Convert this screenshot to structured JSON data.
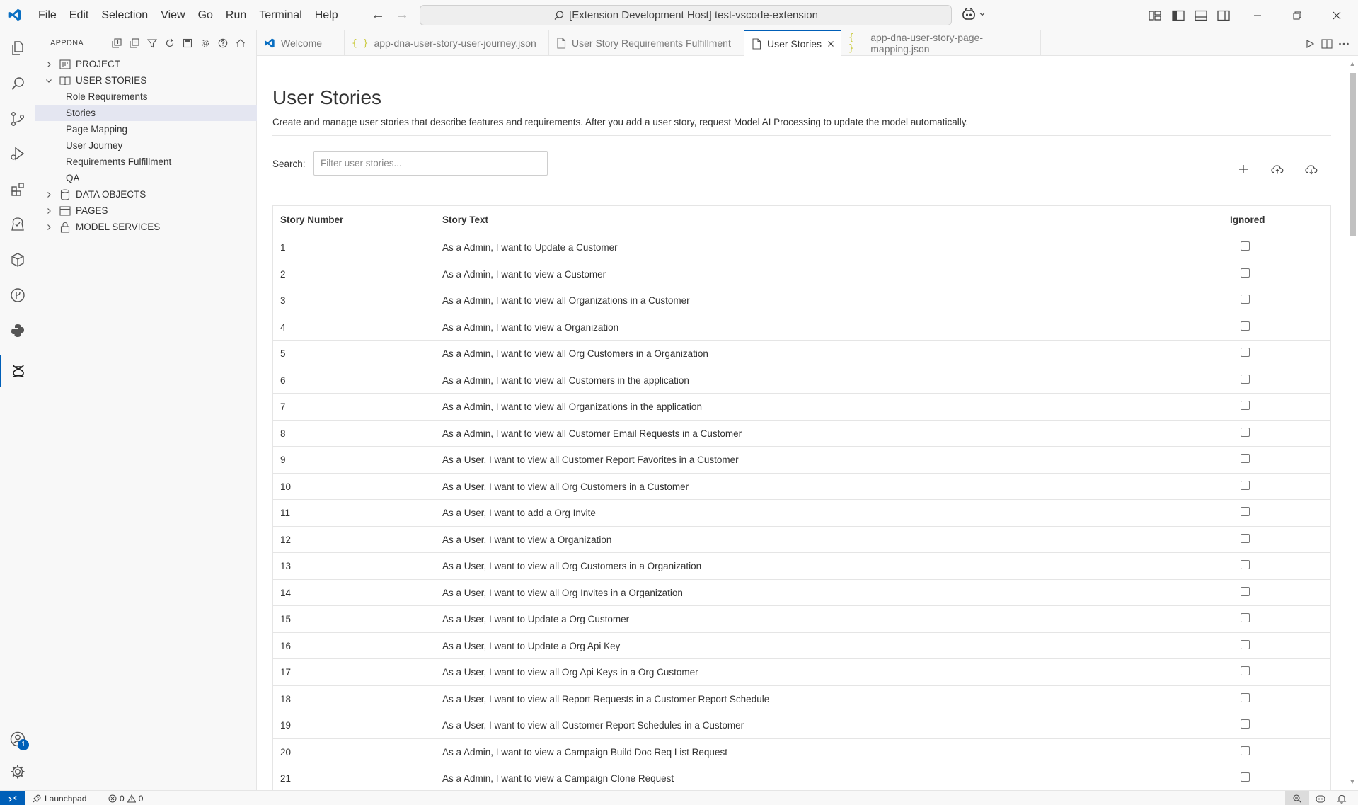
{
  "menu": [
    "File",
    "Edit",
    "Selection",
    "View",
    "Go",
    "Run",
    "Terminal",
    "Help"
  ],
  "command_center": "[Extension Development Host] test-vscode-extension",
  "sidebar": {
    "title": "APPDNA",
    "tree": [
      {
        "label": "PROJECT",
        "expanded": false,
        "icon": "project-icon"
      },
      {
        "label": "USER STORIES",
        "expanded": true,
        "icon": "book-icon"
      },
      {
        "label": "Role Requirements"
      },
      {
        "label": "Stories",
        "selected": true
      },
      {
        "label": "Page Mapping"
      },
      {
        "label": "User Journey"
      },
      {
        "label": "Requirements Fulfillment"
      },
      {
        "label": "QA"
      },
      {
        "label": "DATA OBJECTS",
        "expanded": false,
        "icon": "database-icon"
      },
      {
        "label": "PAGES",
        "expanded": false,
        "icon": "browser-icon"
      },
      {
        "label": "MODEL SERVICES",
        "expanded": false,
        "icon": "lock-icon"
      }
    ]
  },
  "tabs": [
    {
      "label": "Welcome",
      "icon": "vscode-icon"
    },
    {
      "label": "app-dna-user-story-user-journey.json",
      "icon": "json-icon"
    },
    {
      "label": "User Story Requirements Fulfillment",
      "icon": "file-icon"
    },
    {
      "label": "User Stories",
      "icon": "file-icon",
      "active": true
    },
    {
      "label": "app-dna-user-story-page-mapping.json",
      "icon": "json-icon"
    }
  ],
  "page": {
    "title": "User Stories",
    "description": "Create and manage user stories that describe features and requirements. After you add a user story, request Model AI Processing to update the model automatically.",
    "search_label": "Search:",
    "search_placeholder": "Filter user stories..."
  },
  "table": {
    "headers": {
      "number": "Story Number",
      "text": "Story Text",
      "ignored": "Ignored"
    },
    "rows": [
      {
        "n": "1",
        "text": "As a Admin, I want to Update a Customer",
        "ignored": false
      },
      {
        "n": "2",
        "text": "As a Admin, I want to view a Customer",
        "ignored": false
      },
      {
        "n": "3",
        "text": "As a Admin, I want to view all Organizations in a Customer",
        "ignored": false
      },
      {
        "n": "4",
        "text": "As a Admin, I want to view a Organization",
        "ignored": false
      },
      {
        "n": "5",
        "text": "As a Admin, I want to view all Org Customers in a Organization",
        "ignored": false
      },
      {
        "n": "6",
        "text": "As a Admin, I want to view all Customers in the application",
        "ignored": false
      },
      {
        "n": "7",
        "text": "As a Admin, I want to view all Organizations in the application",
        "ignored": false
      },
      {
        "n": "8",
        "text": "As a Admin, I want to view all Customer Email Requests in a Customer",
        "ignored": false
      },
      {
        "n": "9",
        "text": "As a User, I want to view all Customer Report Favorites in a Customer",
        "ignored": false
      },
      {
        "n": "10",
        "text": "As a User, I want to view all Org Customers in a Customer",
        "ignored": false
      },
      {
        "n": "11",
        "text": "As a User, I want to add a Org Invite",
        "ignored": false
      },
      {
        "n": "12",
        "text": "As a User, I want to view a Organization",
        "ignored": false
      },
      {
        "n": "13",
        "text": "As a User, I want to view all Org Customers in a Organization",
        "ignored": false
      },
      {
        "n": "14",
        "text": "As a User, I want to view all Org Invites in a Organization",
        "ignored": false
      },
      {
        "n": "15",
        "text": "As a User, I want to Update a Org Customer",
        "ignored": false
      },
      {
        "n": "16",
        "text": "As a User, I want to Update a Org Api Key",
        "ignored": false
      },
      {
        "n": "17",
        "text": "As a User, I want to view all Org Api Keys in a Org Customer",
        "ignored": false
      },
      {
        "n": "18",
        "text": "As a User, I want to view all Report Requests in a Customer Report Schedule",
        "ignored": false
      },
      {
        "n": "19",
        "text": "As a User, I want to view all Customer Report Schedules in a Customer",
        "ignored": false
      },
      {
        "n": "20",
        "text": "As a Admin, I want to view a Campaign Build Doc Req List Request",
        "ignored": false
      },
      {
        "n": "21",
        "text": "As a Admin, I want to view a Campaign Clone Request",
        "ignored": false
      }
    ]
  },
  "statusbar": {
    "launchpad": "Launchpad",
    "errors": "0",
    "warnings": "0"
  },
  "accounts_badge": "1",
  "colors": {
    "accent": "#005fb8",
    "selection": "#e4e6f1",
    "json_icon": "#cbcb41"
  }
}
